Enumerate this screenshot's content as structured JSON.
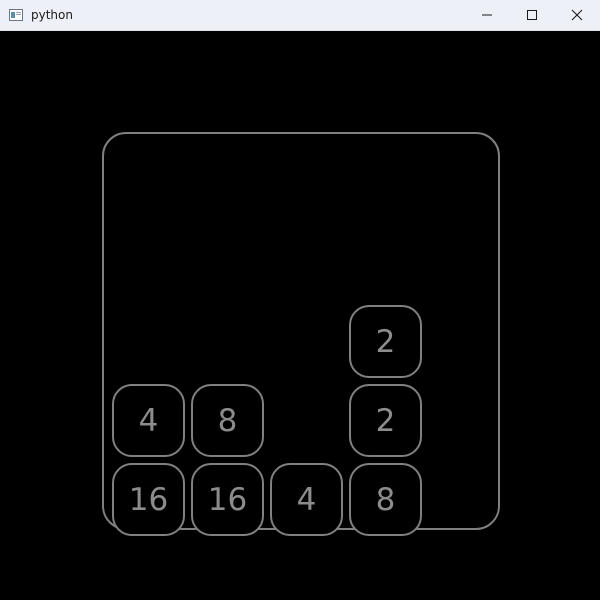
{
  "window": {
    "title": "python",
    "controls": {
      "minimize_icon": "minimize-icon",
      "maximize_icon": "maximize-icon",
      "close_icon": "close-icon"
    }
  },
  "game": {
    "grid_size": 5,
    "grid": [
      [
        null,
        null,
        null,
        null,
        null
      ],
      [
        null,
        null,
        null,
        null,
        null
      ],
      [
        null,
        null,
        null,
        "2",
        null
      ],
      [
        "4",
        "8",
        null,
        "2",
        null
      ],
      [
        "16",
        "16",
        "4",
        "8",
        null
      ]
    ]
  },
  "colors": {
    "background": "#000000",
    "outline": "#808080",
    "tile_text": "#8c8c8c",
    "titlebar": "#eef0f8"
  }
}
